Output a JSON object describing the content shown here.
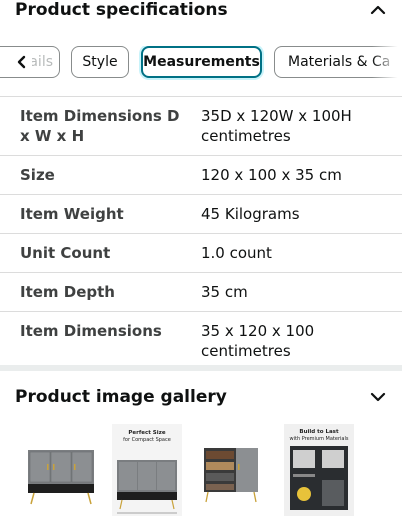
{
  "specs_section": {
    "title": "Product specifications",
    "toggle_icon": "chevron-up-icon"
  },
  "tabs": {
    "scroll_left_icon": "chevron-left-icon",
    "items": [
      {
        "label": "ails",
        "state": "partial"
      },
      {
        "label": "Style",
        "state": "normal"
      },
      {
        "label": "Measurements",
        "state": "active"
      },
      {
        "label": "Materials & Ca",
        "state": "partial"
      }
    ],
    "active_border_color": "#007185"
  },
  "specs": [
    {
      "label": "Item Dimensions D x W x H",
      "value": "35D x 120W x 100H centimetres"
    },
    {
      "label": "Size",
      "value": "120 x 100 x 35 cm"
    },
    {
      "label": "Item Weight",
      "value": "45 Kilograms"
    },
    {
      "label": "Unit Count",
      "value": "1.0 count"
    },
    {
      "label": "Item Depth",
      "value": "35 cm"
    },
    {
      "label": "Item Dimensions",
      "value": "35 x 120 x 100 centimetres"
    }
  ],
  "gallery_section": {
    "title": "Product image gallery",
    "toggle_icon": "chevron-down-icon",
    "thumbnails": [
      {
        "name": "cabinet-front-view"
      },
      {
        "name": "cabinet-size-banner",
        "caption_line1": "Perfect Size",
        "caption_line2": "for Compact Space"
      },
      {
        "name": "cabinet-open-shoes"
      },
      {
        "name": "cabinet-materials-banner",
        "caption_line1": "Build to Last",
        "caption_line2": "with Premium Materials"
      }
    ]
  },
  "colors": {
    "text": "#0f1111",
    "label": "#3f4141",
    "divider": "#dcdcdc",
    "band": "#eaeded",
    "accent": "#007185"
  }
}
